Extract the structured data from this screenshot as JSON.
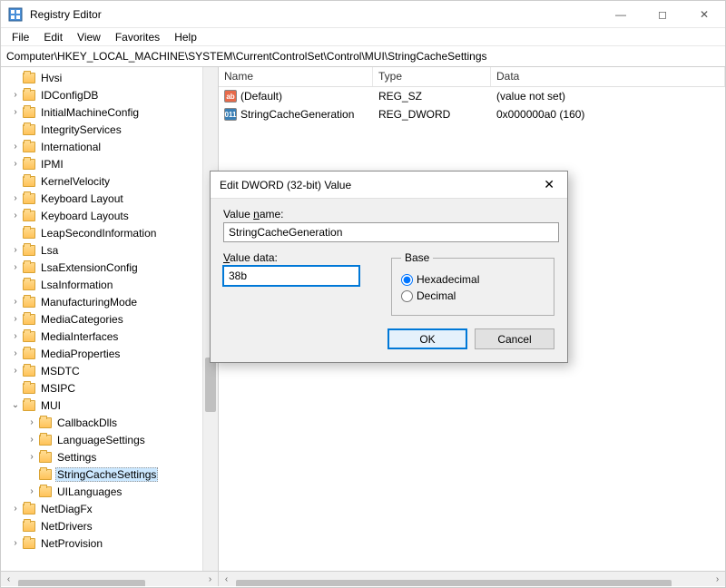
{
  "titlebar": {
    "app_name": "Registry Editor"
  },
  "menu": {
    "file": "File",
    "edit": "Edit",
    "view": "View",
    "favorites": "Favorites",
    "help": "Help"
  },
  "addressbar": {
    "path": "Computer\\HKEY_LOCAL_MACHINE\\SYSTEM\\CurrentControlSet\\Control\\MUI\\StringCacheSettings"
  },
  "tree": {
    "items": [
      {
        "label": "Hvsi",
        "depth": 0,
        "expand": ""
      },
      {
        "label": "IDConfigDB",
        "depth": 0,
        "expand": "›"
      },
      {
        "label": "InitialMachineConfig",
        "depth": 0,
        "expand": "›"
      },
      {
        "label": "IntegrityServices",
        "depth": 0,
        "expand": ""
      },
      {
        "label": "International",
        "depth": 0,
        "expand": "›"
      },
      {
        "label": "IPMI",
        "depth": 0,
        "expand": "›"
      },
      {
        "label": "KernelVelocity",
        "depth": 0,
        "expand": ""
      },
      {
        "label": "Keyboard Layout",
        "depth": 0,
        "expand": "›"
      },
      {
        "label": "Keyboard Layouts",
        "depth": 0,
        "expand": "›"
      },
      {
        "label": "LeapSecondInformation",
        "depth": 0,
        "expand": ""
      },
      {
        "label": "Lsa",
        "depth": 0,
        "expand": "›"
      },
      {
        "label": "LsaExtensionConfig",
        "depth": 0,
        "expand": "›"
      },
      {
        "label": "LsaInformation",
        "depth": 0,
        "expand": ""
      },
      {
        "label": "ManufacturingMode",
        "depth": 0,
        "expand": "›"
      },
      {
        "label": "MediaCategories",
        "depth": 0,
        "expand": "›"
      },
      {
        "label": "MediaInterfaces",
        "depth": 0,
        "expand": "›"
      },
      {
        "label": "MediaProperties",
        "depth": 0,
        "expand": "›"
      },
      {
        "label": "MSDTC",
        "depth": 0,
        "expand": "›"
      },
      {
        "label": "MSIPC",
        "depth": 0,
        "expand": ""
      },
      {
        "label": "MUI",
        "depth": 0,
        "expand": "⌄"
      },
      {
        "label": "CallbackDlls",
        "depth": 1,
        "expand": "›"
      },
      {
        "label": "LanguageSettings",
        "depth": 1,
        "expand": "›"
      },
      {
        "label": "Settings",
        "depth": 1,
        "expand": "›"
      },
      {
        "label": "StringCacheSettings",
        "depth": 1,
        "expand": "",
        "selected": true
      },
      {
        "label": "UILanguages",
        "depth": 1,
        "expand": "›"
      },
      {
        "label": "NetDiagFx",
        "depth": 0,
        "expand": "›"
      },
      {
        "label": "NetDrivers",
        "depth": 0,
        "expand": ""
      },
      {
        "label": "NetProvision",
        "depth": 0,
        "expand": "›"
      }
    ]
  },
  "list": {
    "columns": {
      "name": "Name",
      "type": "Type",
      "data": "Data"
    },
    "rows": [
      {
        "icon": "sz",
        "icon_text": "ab",
        "name": "(Default)",
        "type": "REG_SZ",
        "data": "(value not set)"
      },
      {
        "icon": "dw",
        "icon_text": "011",
        "name": "StringCacheGeneration",
        "type": "REG_DWORD",
        "data": "0x000000a0 (160)"
      }
    ]
  },
  "dialog": {
    "title": "Edit DWORD (32-bit) Value",
    "name_label_pre": "Value ",
    "name_label_ul": "n",
    "name_label_post": "ame:",
    "value_name": "StringCacheGeneration",
    "data_label_pre": "",
    "data_label_ul": "V",
    "data_label_post": "alue data:",
    "value_data": "38b",
    "base_legend": "Base",
    "hex_pre": "",
    "hex_ul": "H",
    "hex_post": "exadecimal",
    "dec_pre": "",
    "dec_ul": "D",
    "dec_post": "ecimal",
    "ok": "OK",
    "cancel": "Cancel"
  }
}
